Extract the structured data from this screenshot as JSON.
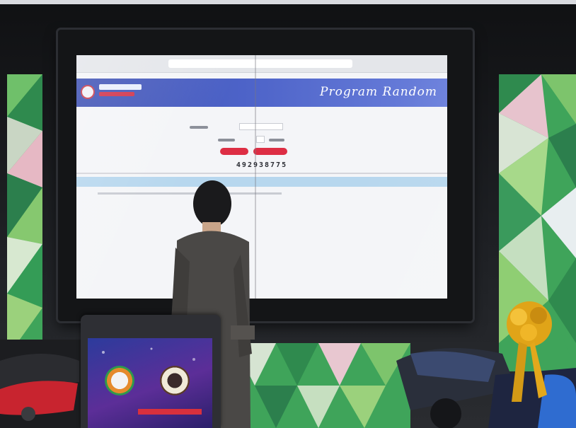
{
  "screen": {
    "banner_title": "Program Random",
    "random_number": "492938775"
  },
  "colors": {
    "banner": "#4d63c8",
    "button": "#dd2e44",
    "result_header": "#b7d7ee",
    "wall_green": "#3fa45a",
    "laptop_wallpaper": "#3a2f9c"
  },
  "icons": {
    "logo": "lottery-office-logo-icon",
    "laptop_left_emblem": "green-orange-emblem-icon",
    "laptop_right_emblem": "royal-seal-emblem-icon"
  }
}
